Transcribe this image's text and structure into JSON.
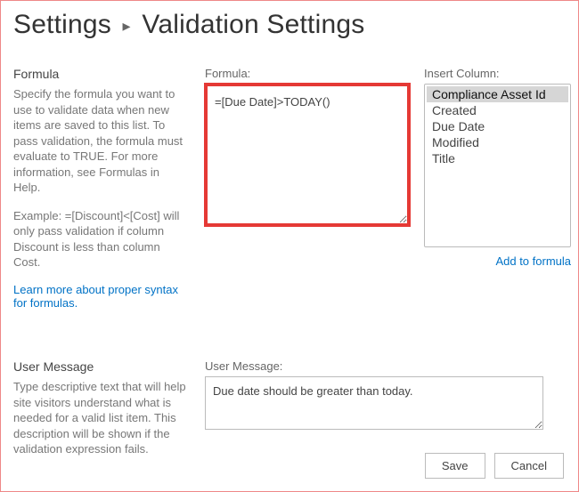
{
  "breadcrumb": {
    "root": "Settings",
    "separator": "▸",
    "page": "Validation Settings"
  },
  "formula_section": {
    "heading": "Formula",
    "help1": "Specify the formula you want to use to validate data when new items are saved to this list. To pass validation, the formula must evaluate to TRUE. For more information, see Formulas in Help.",
    "help2": "Example: =[Discount]<[Cost] will only pass validation if column Discount is less than column Cost.",
    "learn_link": "Learn more about proper syntax for formulas.",
    "field_label": "Formula:",
    "formula_value": "=[Due Date]>TODAY()"
  },
  "columns": {
    "label": "Insert Column:",
    "items": [
      "Compliance Asset Id",
      "Created",
      "Due Date",
      "Modified",
      "Title"
    ],
    "selected_index": 0,
    "add_link": "Add to formula"
  },
  "user_message_section": {
    "heading": "User Message",
    "help": "Type descriptive text that will help site visitors understand what is needed for a valid list item. This description will be shown if the validation expression fails.",
    "field_label": "User Message:",
    "value": "Due date should be greater than today."
  },
  "buttons": {
    "save": "Save",
    "cancel": "Cancel"
  }
}
